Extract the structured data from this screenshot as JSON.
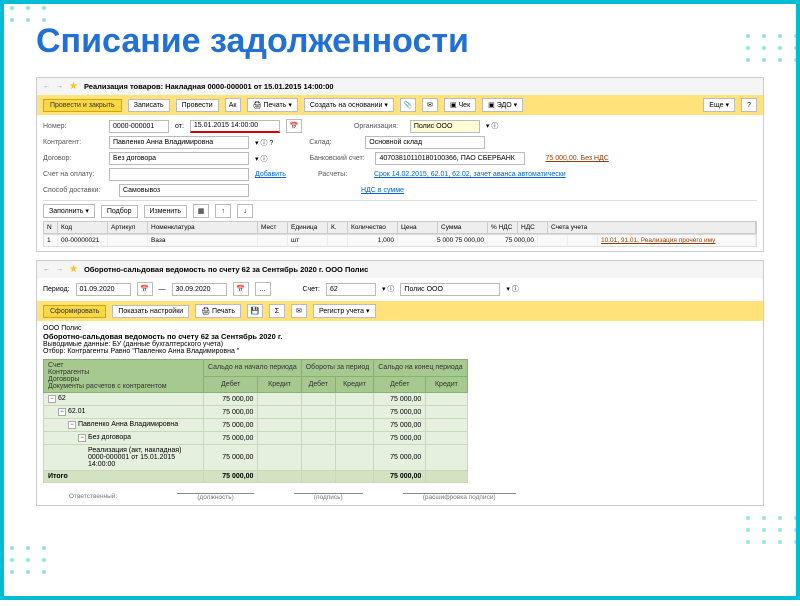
{
  "title": "Списание задолженности",
  "win1": {
    "title": "Реализация товаров: Накладная 0000-000001 от 15.01.2015 14:00:00",
    "btn_primary": "Провести и закрыть",
    "btn_record": "Записать",
    "btn_post": "Провести",
    "btn_print": "Печать",
    "btn_create": "Создать на основании",
    "btn_edo": "ЭДО",
    "btn_check": "Чек",
    "btn_more": "Еще",
    "f": {
      "number_l": "Номер:",
      "number_v": "0000-000001",
      "date_l": "от:",
      "date_v": "15.01.2015 14:00:00",
      "org_l": "Организация:",
      "org_v": "Полис ООО",
      "kontr_l": "Контрагент:",
      "kontr_v": "Павленко Анна Владимировна",
      "sklad_l": "Склад:",
      "sklad_v": "Основной склад",
      "dogovor_l": "Договор:",
      "dogovor_v": "Без договора",
      "bank_l": "Банковский счет:",
      "bank_v": "40703810110180100366, ПАО СБЕРБАНК",
      "schet_l": "Счет на оплату:",
      "add_l": "Добавить",
      "rasch_l": "Расчеты:",
      "rasch_v": "Срок 14.02.2015, 62.01, 62.02, зачет аванса автоматически",
      "dostav_l": "Способ доставки:",
      "dostav_v": "Самовывоз",
      "nds_l": "НДС в сумме"
    },
    "tabbar": {
      "fill": "Заполнить",
      "select": "Подбор",
      "change": "Изменить"
    },
    "thead": [
      "N",
      "Код",
      "Артикул",
      "Номенклатура",
      "Мест",
      "Единица",
      "К.",
      "Количество",
      "Цена",
      "Сумма",
      "% НДС",
      "НДС",
      "Счета учета"
    ],
    "trow": {
      "n": "1",
      "code": "00-00000021",
      "nom": "Ваза",
      "unit": "шт",
      "qty": "1,000",
      "price": "5 000                     75 000,00",
      "sum": "75 000,00",
      "accounts": "10.01, 91.01, Реализация прочего иму"
    }
  },
  "win2": {
    "title": "Оборотно-сальдовая ведомость по счету 62 за Сентябрь 2020 г. ООО Полис",
    "period_l": "Период:",
    "date_from": "01.09.2020",
    "date_to": "30.09.2020",
    "schet_l": "Счет:",
    "schet_v": "62",
    "org_v": "Полис ООО",
    "btn_form": "Сформировать",
    "btn_settings": "Показать настройки",
    "btn_print": "Печать",
    "btn_reg": "Регистр учета",
    "report": {
      "org": "ООО Полис",
      "title": "Оборотно-сальдовая ведомость по счету 62 за Сентябрь 2020 г.",
      "output": "Выводимые данные:   БУ (данные бухгалтерского учета)",
      "filter": "Отбор:                         Контрагенты Равно \"Павленко Анна Владимировна \""
    },
    "thead": {
      "c1": "Счет",
      "c1a": "Контрагенты",
      "c1b": "Договоры",
      "c1c": "Документы расчетов с контрагентом",
      "g1": "Сальдо на начало периода",
      "g2": "Обороты за период",
      "g3": "Сальдо на конец периода",
      "d": "Дебет",
      "k": "Кредит"
    },
    "rows": [
      {
        "label": "62",
        "v1": "75 000,00",
        "v2": "",
        "v3": "",
        "v4": "",
        "v5": "75 000,00",
        "v6": ""
      },
      {
        "label": "62.01",
        "v1": "75 000,00",
        "v2": "",
        "v3": "",
        "v4": "",
        "v5": "75 000,00",
        "v6": ""
      },
      {
        "label": "Павленко Анна Владимировна",
        "v1": "75 000,00",
        "v2": "",
        "v3": "",
        "v4": "",
        "v5": "75 000,00",
        "v6": ""
      },
      {
        "label": "Без договора",
        "v1": "75 000,00",
        "v2": "",
        "v3": "",
        "v4": "",
        "v5": "75 000,00",
        "v6": ""
      },
      {
        "label": "Реализация (акт, накладная) 0000-000001 от 15.01.2015 14:00:00",
        "v1": "75 000,00",
        "v2": "",
        "v3": "",
        "v4": "",
        "v5": "75 000,00",
        "v6": ""
      }
    ],
    "total": {
      "label": "Итого",
      "v1": "75 000,00",
      "v5": "75 000,00"
    },
    "sign": {
      "otv": "Ответственный:",
      "d": "(должность)",
      "p": "(подпись)",
      "r": "(расшифровка подписи)"
    }
  }
}
